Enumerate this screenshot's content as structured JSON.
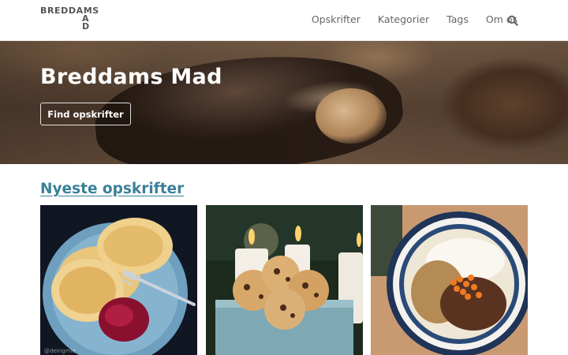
{
  "header": {
    "logo_line1": "BREDDAMS",
    "logo_line2": [
      "A",
      "D"
    ],
    "nav": [
      "Opskrifter",
      "Kategorier",
      "Tags",
      "Om os"
    ],
    "search_icon": "search-icon"
  },
  "hero": {
    "title": "Breddams Mad",
    "button_label": "Find opskrifter"
  },
  "latest": {
    "title": "Nyeste opskrifter",
    "cards": [
      {
        "image": "pancakes-with-jam",
        "credit": "@deingmie"
      },
      {
        "image": "cookies-in-tin-with-candles",
        "credit": ""
      },
      {
        "image": "porridge-bowl-with-berries",
        "credit": ""
      }
    ]
  },
  "colors": {
    "accent": "#3a7f9a",
    "nav_text": "#666666",
    "hero_text": "#ffffff"
  }
}
